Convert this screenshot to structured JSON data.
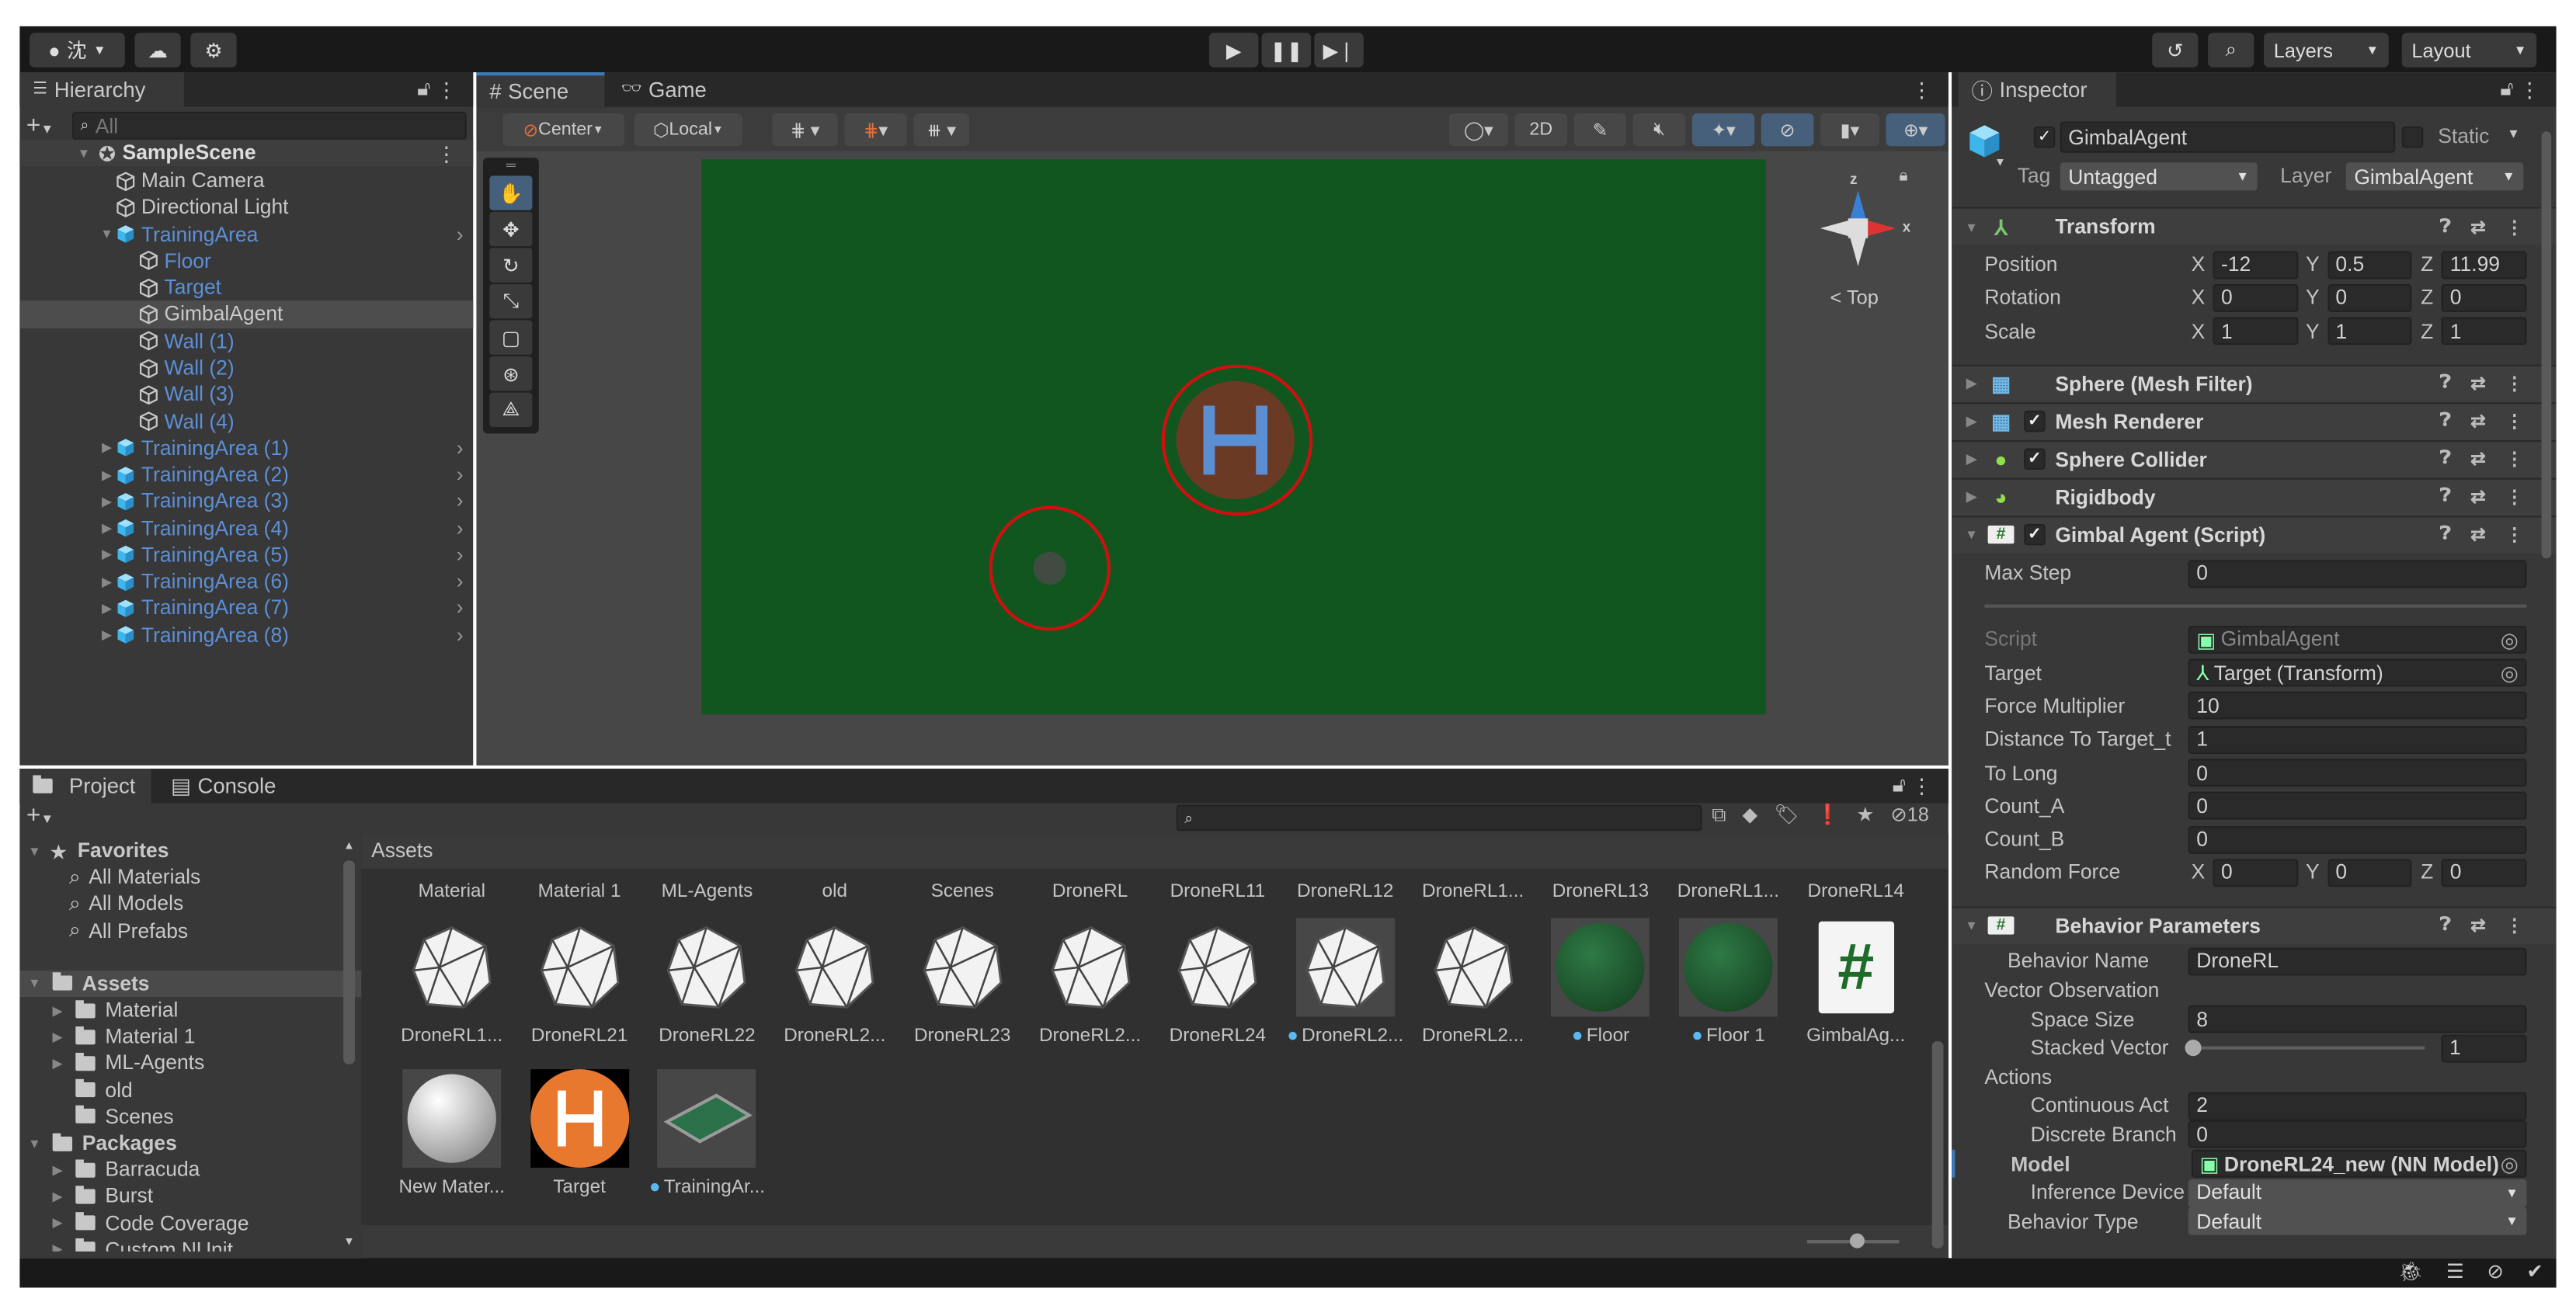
{
  "toolbar": {
    "account": "沈",
    "layers": "Layers",
    "layout": "Layout"
  },
  "hierarchy": {
    "title": "Hierarchy",
    "search_placeholder": "All",
    "scene": "SampleScene",
    "items": [
      {
        "label": "Main Camera",
        "depth": 1
      },
      {
        "label": "Directional Light",
        "depth": 1
      },
      {
        "label": "TrainingArea",
        "depth": 1,
        "expanded": true,
        "blue": true,
        "prefab": true
      },
      {
        "label": "Floor",
        "depth": 2,
        "blue": true
      },
      {
        "label": "Target",
        "depth": 2,
        "blue": true
      },
      {
        "label": "GimbalAgent",
        "depth": 2,
        "selected": true
      },
      {
        "label": "Wall (1)",
        "depth": 2,
        "blue": true
      },
      {
        "label": "Wall (2)",
        "depth": 2,
        "blue": true
      },
      {
        "label": "Wall (3)",
        "depth": 2,
        "blue": true
      },
      {
        "label": "Wall (4)",
        "depth": 2,
        "blue": true
      },
      {
        "label": "TrainingArea (1)",
        "depth": 1,
        "collapsed": true,
        "blue": true,
        "prefab": true
      },
      {
        "label": "TrainingArea (2)",
        "depth": 1,
        "collapsed": true,
        "blue": true,
        "prefab": true
      },
      {
        "label": "TrainingArea (3)",
        "depth": 1,
        "collapsed": true,
        "blue": true,
        "prefab": true
      },
      {
        "label": "TrainingArea (4)",
        "depth": 1,
        "collapsed": true,
        "blue": true,
        "prefab": true
      },
      {
        "label": "TrainingArea (5)",
        "depth": 1,
        "collapsed": true,
        "blue": true,
        "prefab": true
      },
      {
        "label": "TrainingArea (6)",
        "depth": 1,
        "collapsed": true,
        "blue": true,
        "prefab": true
      },
      {
        "label": "TrainingArea (7)",
        "depth": 1,
        "collapsed": true,
        "blue": true,
        "prefab": true
      },
      {
        "label": "TrainingArea (8)",
        "depth": 1,
        "collapsed": true,
        "blue": true,
        "prefab": true
      }
    ]
  },
  "scene": {
    "tabs": [
      "Scene",
      "Game"
    ],
    "pivot": "Center",
    "space": "Local",
    "mode_2d": "2D",
    "gizmo": {
      "view": "Top",
      "x": "x",
      "z": "z"
    },
    "colors": {
      "ground": "#11561f",
      "viewport": "#474747",
      "target_marker": "#d01010"
    }
  },
  "inspector": {
    "title": "Inspector",
    "object_name": "GimbalAgent",
    "static_label": "Static",
    "tag_label": "Tag",
    "tag": "Untagged",
    "layer_label": "Layer",
    "layer": "GimbalAgent",
    "components": [
      {
        "name": "Transform",
        "icon": "transform",
        "expanded": true,
        "fields": [
          {
            "kind": "vec3",
            "label": "Position",
            "x": "-12",
            "y": "0.5",
            "z": "11.99"
          },
          {
            "kind": "vec3",
            "label": "Rotation",
            "x": "0",
            "y": "0",
            "z": "0"
          },
          {
            "kind": "vec3",
            "label": "Scale",
            "x": "1",
            "y": "1",
            "z": "1"
          }
        ]
      },
      {
        "name": "Sphere (Mesh Filter)",
        "icon": "mesh-filter"
      },
      {
        "name": "Mesh Renderer",
        "icon": "mesh-renderer",
        "checkbox": true
      },
      {
        "name": "Sphere Collider",
        "icon": "sphere-collider",
        "checkbox": true
      },
      {
        "name": "Rigidbody",
        "icon": "rigidbody"
      },
      {
        "name": "Gimbal Agent (Script)",
        "icon": "script",
        "checkbox": true,
        "expanded": true,
        "fields": [
          {
            "kind": "text",
            "label": "Max Step",
            "value": "0"
          },
          {
            "kind": "separator"
          },
          {
            "kind": "object",
            "label": "Script",
            "value": "GimbalAgent",
            "disabled": true
          },
          {
            "kind": "object",
            "label": "Target",
            "value": "Target (Transform)"
          },
          {
            "kind": "text",
            "label": "Force Multiplier",
            "value": "10"
          },
          {
            "kind": "text",
            "label": "Distance To Target_t",
            "value": "1"
          },
          {
            "kind": "text",
            "label": "To Long",
            "value": "0"
          },
          {
            "kind": "text",
            "label": "Count_A",
            "value": "0"
          },
          {
            "kind": "text",
            "label": "Count_B",
            "value": "0"
          },
          {
            "kind": "vec3",
            "label": "Random Force",
            "x": "0",
            "y": "0",
            "z": "0"
          }
        ]
      },
      {
        "name": "Behavior Parameters",
        "icon": "script",
        "expanded": true,
        "compact": true,
        "fields": [
          {
            "kind": "text",
            "label": "Behavior Name",
            "value": "DroneRL",
            "indent": 1
          },
          {
            "kind": "label",
            "label": "Vector Observation",
            "indent": 1
          },
          {
            "kind": "text",
            "label": "Space Size",
            "value": "8",
            "indent": 2
          },
          {
            "kind": "slider",
            "label": "Stacked Vector",
            "value": "1",
            "fraction": 0,
            "indent": 2
          },
          {
            "kind": "label",
            "label": "Actions",
            "indent": 1
          },
          {
            "kind": "text",
            "label": "Continuous Act",
            "value": "2",
            "indent": 2
          },
          {
            "kind": "text",
            "label": "Discrete Branch",
            "value": "0",
            "indent": 2
          },
          {
            "kind": "object",
            "label": "Model",
            "value": "DroneRL24_new (NN Model)",
            "indent": 1,
            "bold": true
          },
          {
            "kind": "dropdown",
            "label": "Inference Device",
            "value": "Default",
            "indent": 2
          },
          {
            "kind": "dropdown",
            "label": "Behavior Type",
            "value": "Default",
            "indent": 1
          }
        ]
      }
    ]
  },
  "project": {
    "tabs": [
      "Project",
      "Console"
    ],
    "hidden_count": "18",
    "favorites": {
      "label": "Favorites",
      "items": [
        "All Materials",
        "All Models",
        "All Prefabs"
      ]
    },
    "tree": [
      {
        "label": "Assets",
        "depth": 0,
        "open": true,
        "selected": true
      },
      {
        "label": "Material",
        "depth": 1,
        "arrow": true
      },
      {
        "label": "Material 1",
        "depth": 1,
        "arrow": true
      },
      {
        "label": "ML-Agents",
        "depth": 1,
        "arrow": true
      },
      {
        "label": "old",
        "depth": 1
      },
      {
        "label": "Scenes",
        "depth": 1
      },
      {
        "label": "Packages",
        "depth": 0,
        "open": true
      },
      {
        "label": "Barracuda",
        "depth": 1,
        "arrow": true
      },
      {
        "label": "Burst",
        "depth": 1,
        "arrow": true
      },
      {
        "label": "Code Coverage",
        "depth": 1,
        "arrow": true
      },
      {
        "label": "Custom NUnit",
        "depth": 1,
        "arrow": true
      }
    ],
    "breadcrumb": "Assets",
    "grid_row_top_labels": [
      "Material",
      "Material 1",
      "ML-Agents",
      "old",
      "Scenes",
      "DroneRL",
      "DroneRL11",
      "DroneRL12",
      "DroneRL1...",
      "DroneRL13",
      "DroneRL1...",
      "DroneRL14"
    ],
    "grid": [
      {
        "label": "DroneRL1...",
        "type": "model"
      },
      {
        "label": "DroneRL21",
        "type": "model"
      },
      {
        "label": "DroneRL22",
        "type": "model"
      },
      {
        "label": "DroneRL2...",
        "type": "model"
      },
      {
        "label": "DroneRL23",
        "type": "model"
      },
      {
        "label": "DroneRL2...",
        "type": "model"
      },
      {
        "label": "DroneRL24",
        "type": "model"
      },
      {
        "label": "DroneRL2...",
        "type": "model",
        "boxed": true
      },
      {
        "label": "DroneRL2...",
        "type": "model"
      },
      {
        "label": "Floor",
        "type": "green-material",
        "prefab_badge": true
      },
      {
        "label": "Floor 1",
        "type": "green-material",
        "prefab_badge": true
      },
      {
        "label": "GimbalAg...",
        "type": "script"
      },
      {
        "label": "New Mater...",
        "type": "white-material"
      },
      {
        "label": "Target",
        "type": "helipad"
      },
      {
        "label": "TrainingAr...",
        "type": "prefab-plane",
        "prefab_badge": true
      }
    ]
  }
}
